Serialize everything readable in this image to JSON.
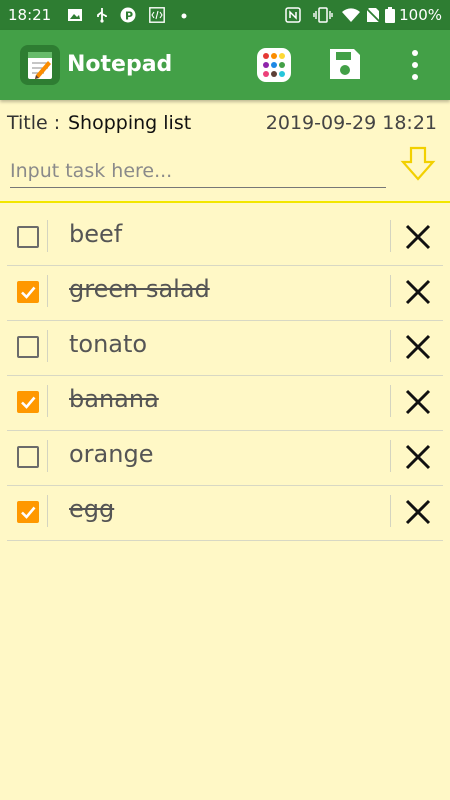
{
  "status_bar": {
    "time": "18:21",
    "battery": "100%",
    "left_icons": [
      "image-icon",
      "usb-icon",
      "parking-icon",
      "code-icon",
      "dot-icon"
    ],
    "right_icons": [
      "nfc-icon",
      "vibrate-icon",
      "wifi-icon",
      "no-sim-icon",
      "battery-icon"
    ]
  },
  "app_bar": {
    "title": "Notepad",
    "actions": [
      "palette-icon",
      "save-icon",
      "more-vert-icon"
    ]
  },
  "note": {
    "title_label": "Title : ",
    "title_value": "Shopping list",
    "timestamp": "2019-09-29 18:21"
  },
  "input": {
    "placeholder": "Input task here...",
    "value": ""
  },
  "tasks": [
    {
      "label": "beef",
      "checked": false
    },
    {
      "label": "green salad",
      "checked": true
    },
    {
      "label": "tonato",
      "checked": false
    },
    {
      "label": "banana",
      "checked": true
    },
    {
      "label": "orange",
      "checked": false
    },
    {
      "label": "egg",
      "checked": true
    }
  ],
  "colors": {
    "status_bar": "#2E7D32",
    "app_bar": "#43A047",
    "background": "#FFF8C6",
    "checkbox_checked": "#FF9800",
    "divider": "#F2E600"
  }
}
